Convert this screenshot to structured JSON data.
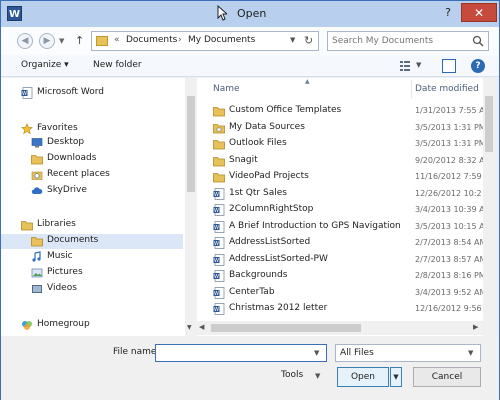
{
  "window": {
    "title": "Open",
    "app_icon_letter": "W",
    "help_glyph": "?",
    "close_glyph": "✕"
  },
  "address": {
    "breadcrumb_sep": "«",
    "crumbs": [
      "Documents",
      "My Documents"
    ],
    "crumb_sep": "›",
    "search_placeholder": "Search My Documents"
  },
  "toolbar": {
    "organize_label": "Organize ▾",
    "new_folder_label": "New folder",
    "help_glyph": "?"
  },
  "navigation": [
    {
      "label": "Microsoft Word",
      "icon": "word-icon",
      "indent": 0
    },
    {
      "label": "Favorites",
      "icon": "star-icon",
      "indent": 0
    },
    {
      "label": "Desktop",
      "icon": "desktop-icon",
      "indent": 1
    },
    {
      "label": "Downloads",
      "icon": "downloads-icon",
      "indent": 1
    },
    {
      "label": "Recent places",
      "icon": "recent-places-icon",
      "indent": 1
    },
    {
      "label": "SkyDrive",
      "icon": "cloud-icon",
      "indent": 1
    },
    {
      "label": "Libraries",
      "icon": "libraries-icon",
      "indent": 0
    },
    {
      "label": "Documents",
      "icon": "documents-icon",
      "indent": 1,
      "selected": true
    },
    {
      "label": "Music",
      "icon": "music-icon",
      "indent": 1
    },
    {
      "label": "Pictures",
      "icon": "pictures-icon",
      "indent": 1
    },
    {
      "label": "Videos",
      "icon": "videos-icon",
      "indent": 1
    },
    {
      "label": "Homegroup",
      "icon": "homegroup-icon",
      "indent": 0
    }
  ],
  "files": {
    "columns": {
      "name": "Name",
      "date": "Date modified"
    },
    "rows": [
      {
        "name": "Custom Office Templates",
        "date": "1/31/2013 7:55 A",
        "type": "folder"
      },
      {
        "name": "My Data Sources",
        "date": "3/5/2013 1:31 PM",
        "type": "data-folder"
      },
      {
        "name": "Outlook Files",
        "date": "3/5/2013 1:31 PM",
        "type": "folder"
      },
      {
        "name": "Snagit",
        "date": "9/20/2012 8:32 A",
        "type": "folder"
      },
      {
        "name": "VideoPad Projects",
        "date": "11/16/2012 7:59",
        "type": "folder"
      },
      {
        "name": "1st Qtr Sales",
        "date": "12/26/2012 10:2",
        "type": "word"
      },
      {
        "name": "2ColumnRightStop",
        "date": "3/4/2013 10:39 A",
        "type": "word"
      },
      {
        "name": "A Brief Introduction to GPS Navigation",
        "date": "3/5/2013 10:15 A",
        "type": "word"
      },
      {
        "name": "AddressListSorted",
        "date": "2/7/2013 8:54 AM",
        "type": "word"
      },
      {
        "name": "AddressListSorted-PW",
        "date": "2/7/2013 8:57 AM",
        "type": "word"
      },
      {
        "name": "Backgrounds",
        "date": "2/8/2013 8:16 PM",
        "type": "word"
      },
      {
        "name": "CenterTab",
        "date": "3/4/2013 9:52 AM",
        "type": "word"
      },
      {
        "name": "Christmas 2012 letter",
        "date": "12/16/2012 9:56",
        "type": "word"
      }
    ]
  },
  "bottom": {
    "filename_label": "File name:",
    "filename_value": "",
    "filetype_value": "All Files",
    "tools_label": "Tools",
    "open_label": "Open",
    "cancel_label": "Cancel"
  }
}
